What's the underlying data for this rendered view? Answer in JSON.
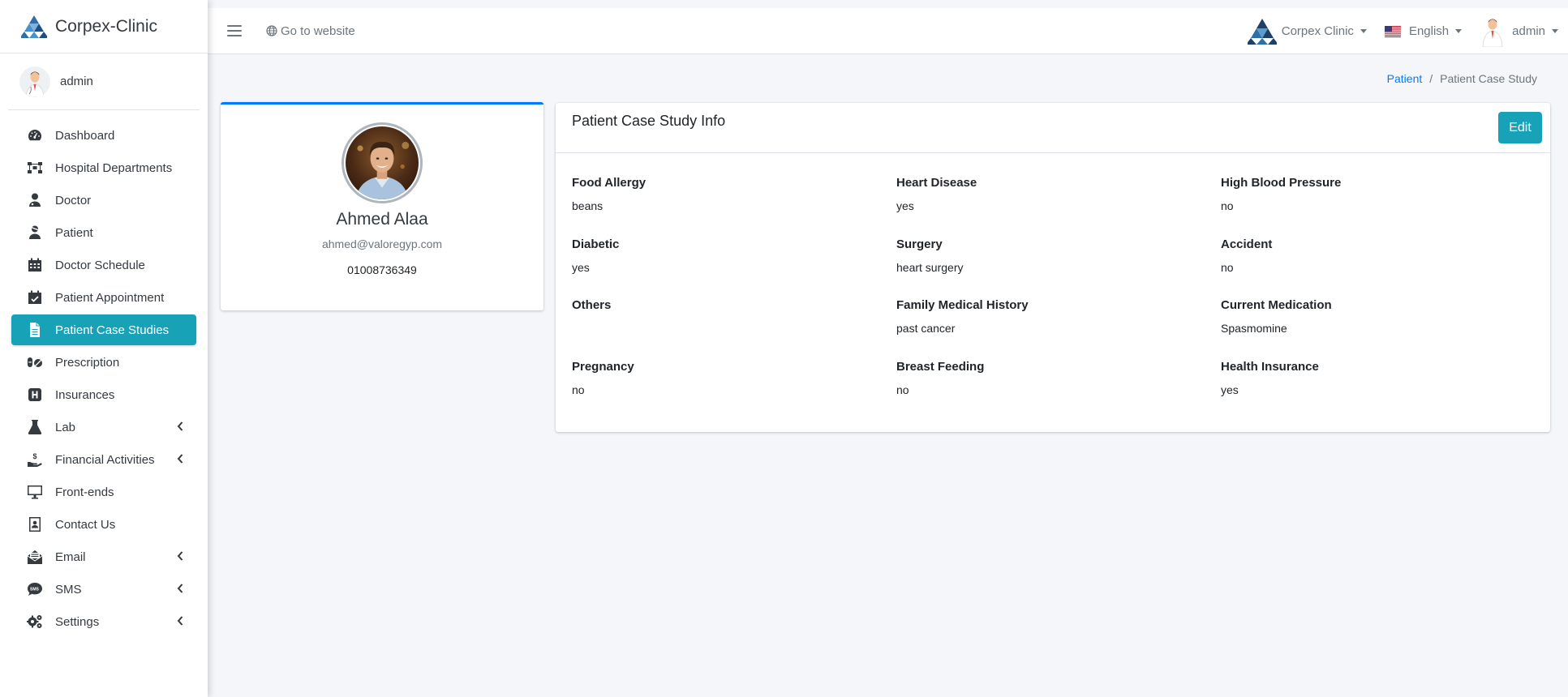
{
  "brand": {
    "name": "Corpex-Clinic"
  },
  "sidebar": {
    "user": {
      "name": "admin"
    },
    "items": [
      {
        "label": "Dashboard",
        "icon": "tachometer-icon",
        "active": false,
        "has_children": false
      },
      {
        "label": "Hospital Departments",
        "icon": "sitemap-icon",
        "active": false,
        "has_children": false
      },
      {
        "label": "Doctor",
        "icon": "user-md-icon",
        "active": false,
        "has_children": false
      },
      {
        "label": "Patient",
        "icon": "user-injured-icon",
        "active": false,
        "has_children": false
      },
      {
        "label": "Doctor Schedule",
        "icon": "calendar-icon",
        "active": false,
        "has_children": false
      },
      {
        "label": "Patient Appointment",
        "icon": "calendar-check-icon",
        "active": false,
        "has_children": false
      },
      {
        "label": "Patient Case Studies",
        "icon": "file-icon",
        "active": true,
        "has_children": false
      },
      {
        "label": "Prescription",
        "icon": "pills-icon",
        "active": false,
        "has_children": false
      },
      {
        "label": "Insurances",
        "icon": "hospital-icon",
        "active": false,
        "has_children": false
      },
      {
        "label": "Lab",
        "icon": "flask-icon",
        "active": false,
        "has_children": true
      },
      {
        "label": "Financial Activities",
        "icon": "hand-holding-dollar-icon",
        "active": false,
        "has_children": true
      },
      {
        "label": "Front-ends",
        "icon": "desktop-icon",
        "active": false,
        "has_children": false
      },
      {
        "label": "Contact Us",
        "icon": "address-card-icon",
        "active": false,
        "has_children": false
      },
      {
        "label": "Email",
        "icon": "envelope-open-icon",
        "active": false,
        "has_children": true
      },
      {
        "label": "SMS",
        "icon": "sms-icon",
        "active": false,
        "has_children": true
      },
      {
        "label": "Settings",
        "icon": "cogs-icon",
        "active": false,
        "has_children": true
      }
    ]
  },
  "topbar": {
    "goto_label": "Go to website",
    "clinic_label": "Corpex Clinic",
    "language_label": "English",
    "user_label": "admin"
  },
  "breadcrumb": {
    "parent": "Patient",
    "current": "Patient Case Study"
  },
  "profile": {
    "name": "Ahmed Alaa",
    "email": "ahmed@valoregyp.com",
    "phone": "01008736349"
  },
  "case_study": {
    "title": "Patient Case Study Info",
    "edit_label": "Edit",
    "fields": [
      {
        "label": "Food Allergy",
        "value": "beans"
      },
      {
        "label": "Heart Disease",
        "value": "yes"
      },
      {
        "label": "High Blood Pressure",
        "value": "no"
      },
      {
        "label": "Diabetic",
        "value": "yes"
      },
      {
        "label": "Surgery",
        "value": "heart surgery"
      },
      {
        "label": "Accident",
        "value": "no"
      },
      {
        "label": "Others",
        "value": ""
      },
      {
        "label": "Family Medical History",
        "value": "past cancer"
      },
      {
        "label": "Current Medication",
        "value": "Spasmomine"
      },
      {
        "label": "Pregnancy",
        "value": "no"
      },
      {
        "label": "Breast Feeding",
        "value": "no"
      },
      {
        "label": "Health Insurance",
        "value": "yes"
      }
    ]
  },
  "colors": {
    "accent": "#17a2b8",
    "primary": "#007bff",
    "text": "#343a40",
    "muted": "#6c757d"
  }
}
